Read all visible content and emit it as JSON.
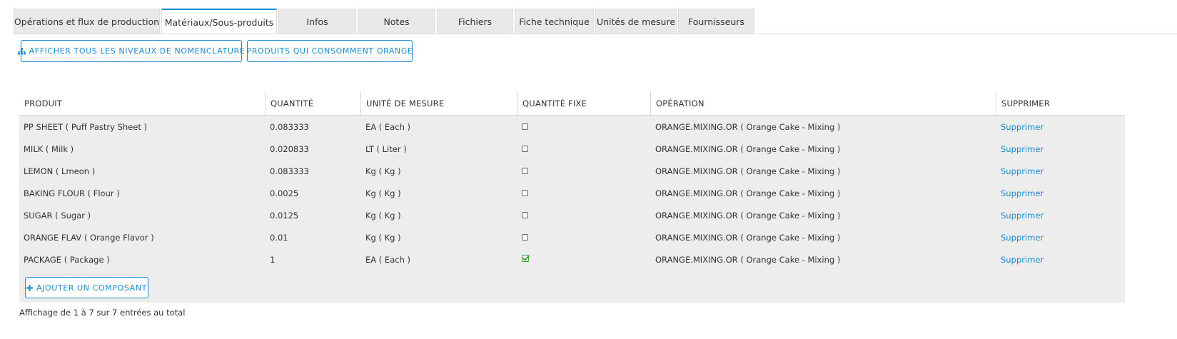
{
  "tabs": [
    {
      "label": "Opérations et flux de production",
      "active": false
    },
    {
      "label": "Matériaux/Sous-produits",
      "active": true
    },
    {
      "label": "Infos",
      "active": false
    },
    {
      "label": "Notes",
      "active": false
    },
    {
      "label": "Fichiers",
      "active": false
    },
    {
      "label": "Fiche technique",
      "active": false
    },
    {
      "label": "Unités de mesure",
      "active": false
    },
    {
      "label": "Fournisseurs",
      "active": false
    }
  ],
  "toolbar": {
    "show_levels_label": "AFFICHER TOUS LES NIVEAUX DE NOMENCLATURE",
    "consumers_label": "PRODUITS QUI CONSOMMENT ORANGE"
  },
  "table": {
    "columns": [
      "PRODUIT",
      "QUANTITÉ",
      "UNITÉ DE MESURE",
      "QUANTITÉ FIXE",
      "OPÉRATION",
      "SUPPRIMER"
    ],
    "rows": [
      {
        "product": "PP SHEET ( Puff Pastry Sheet )",
        "quantity": "0.083333",
        "unit": "EA ( Each )",
        "fixed": false,
        "operation": "ORANGE.MIXING.OR ( Orange Cake - Mixing )",
        "delete": "Supprimer"
      },
      {
        "product": "MILK ( Milk )",
        "quantity": "0.020833",
        "unit": "LT ( Liter )",
        "fixed": false,
        "operation": "ORANGE.MIXING.OR ( Orange Cake - Mixing )",
        "delete": "Supprimer"
      },
      {
        "product": "LEMON ( Lmeon )",
        "quantity": "0.083333",
        "unit": "Kg ( Kg )",
        "fixed": false,
        "operation": "ORANGE.MIXING.OR ( Orange Cake - Mixing )",
        "delete": "Supprimer"
      },
      {
        "product": "BAKING FLOUR ( Flour )",
        "quantity": "0.0025",
        "unit": "Kg ( Kg )",
        "fixed": false,
        "operation": "ORANGE.MIXING.OR ( Orange Cake - Mixing )",
        "delete": "Supprimer"
      },
      {
        "product": "SUGAR ( Sugar )",
        "quantity": "0.0125",
        "unit": "Kg ( Kg )",
        "fixed": false,
        "operation": "ORANGE.MIXING.OR ( Orange Cake - Mixing )",
        "delete": "Supprimer"
      },
      {
        "product": "ORANGE FLAV ( Orange Flavor )",
        "quantity": "0.01",
        "unit": "Kg ( Kg )",
        "fixed": false,
        "operation": "ORANGE.MIXING.OR ( Orange Cake - Mixing )",
        "delete": "Supprimer"
      },
      {
        "product": "PACKAGE ( Package )",
        "quantity": "1",
        "unit": "EA ( Each )",
        "fixed": true,
        "operation": "ORANGE.MIXING.OR ( Orange Cake - Mixing )",
        "delete": "Supprimer"
      }
    ],
    "add_component_label": "AJOUTER UN COMPOSANT"
  },
  "footer": {
    "summary": "Affichage de 1 à 7 sur 7 entrées au total"
  },
  "colors": {
    "accent": "#1a8ccf",
    "row_background": "#ededed",
    "check_green": "#3a9a3a"
  },
  "icons": {
    "hierarchy": "sitemap-icon",
    "plus": "plus-icon",
    "checked": "checked-checkbox-icon",
    "unchecked": "unchecked-checkbox-icon"
  }
}
